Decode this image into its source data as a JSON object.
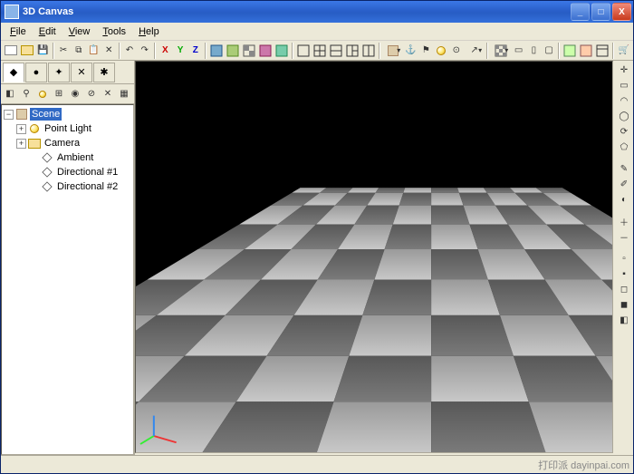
{
  "window": {
    "title": "3D Canvas"
  },
  "menu": {
    "items": [
      "File",
      "Edit",
      "View",
      "Tools",
      "Help"
    ]
  },
  "winbtns": {
    "min": "_",
    "max": "□",
    "close": "X"
  },
  "axes": {
    "x": "X",
    "y": "Y",
    "z": "Z"
  },
  "tree": {
    "root": "Scene",
    "items": [
      {
        "label": "Point Light",
        "expandable": true,
        "icon": "bulb",
        "indent": 1
      },
      {
        "label": "Camera",
        "expandable": true,
        "icon": "folder",
        "indent": 1
      },
      {
        "label": "Ambient",
        "expandable": false,
        "icon": "diam",
        "indent": 2
      },
      {
        "label": "Directional #1",
        "expandable": false,
        "icon": "diam",
        "indent": 2
      },
      {
        "label": "Directional #2",
        "expandable": false,
        "icon": "diam",
        "indent": 2
      }
    ]
  },
  "status": {
    "watermark": "打印派 dayinpai.com"
  }
}
